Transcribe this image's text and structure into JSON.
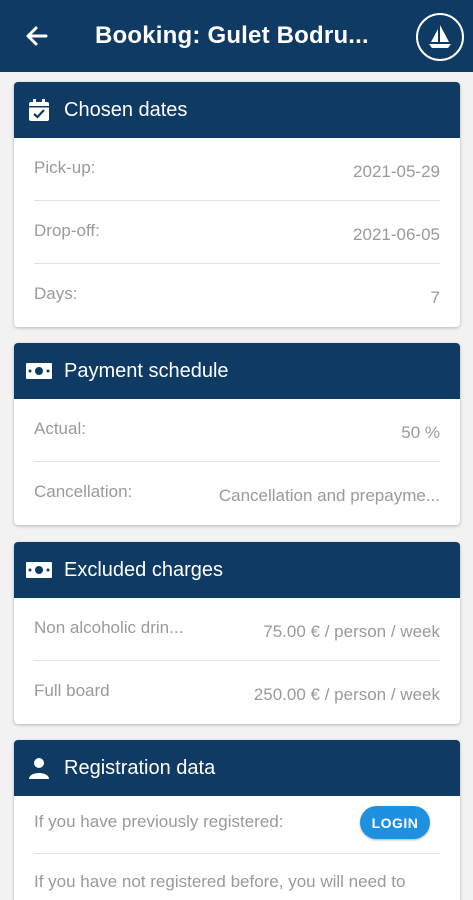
{
  "appbar": {
    "title": "Booking: Gulet Bodru...",
    "back_icon": "arrow-left-icon",
    "logo_icon": "sailboat-logo-icon"
  },
  "chosen_dates": {
    "header": "Chosen dates",
    "icon": "calendar-check-icon",
    "rows": [
      {
        "label": "Pick-up:",
        "value": "2021-05-29"
      },
      {
        "label": "Drop-off:",
        "value": "2021-06-05"
      },
      {
        "label": "Days:",
        "value": "7"
      }
    ]
  },
  "payment_schedule": {
    "header": "Payment schedule",
    "icon": "money-bill-icon",
    "rows": [
      {
        "label": "Actual:",
        "value": "50 %"
      },
      {
        "label": "Cancellation:",
        "value": "Cancellation and prepayme..."
      }
    ]
  },
  "excluded_charges": {
    "header": "Excluded charges",
    "icon": "money-bill-icon",
    "rows": [
      {
        "label": "Non alcoholic drin...",
        "value": "75.00 € / person / week"
      },
      {
        "label": "Full board",
        "value": "250.00 € / person / week"
      }
    ]
  },
  "registration": {
    "header": "Registration data",
    "icon": "user-icon",
    "previously_text": "If you have previously registered:",
    "login_label": "LOGIN",
    "not_registered_text": "If you have not registered before, you will need to"
  },
  "colors": {
    "primary": "#0f3a63",
    "accent": "#1e90e0",
    "muted_text": "#9a9a9a"
  }
}
